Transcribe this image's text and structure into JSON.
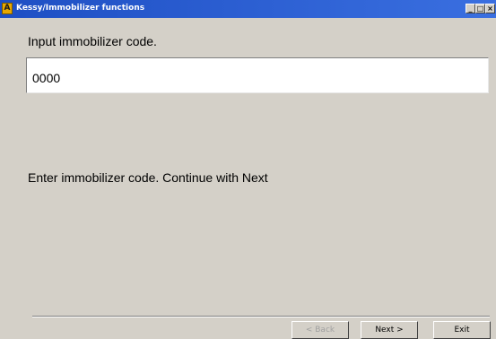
{
  "window": {
    "app_icon_letter": "A",
    "title": "Kessy/Immobilizer functions",
    "controls": {
      "minimize": "_",
      "maximize": "□",
      "close": "×"
    }
  },
  "main": {
    "prompt": "Input immobilizer code.",
    "code_value": "0000",
    "instruction": "Enter immobilizer code. Continue with Next"
  },
  "footer": {
    "back_label": "< Back",
    "back_enabled": false,
    "next_label": "Next >",
    "exit_label": "Exit"
  },
  "colors": {
    "titlebar": "#2f5fcf",
    "window_background": "#d4d0c8",
    "app_icon": "#e8a800"
  }
}
